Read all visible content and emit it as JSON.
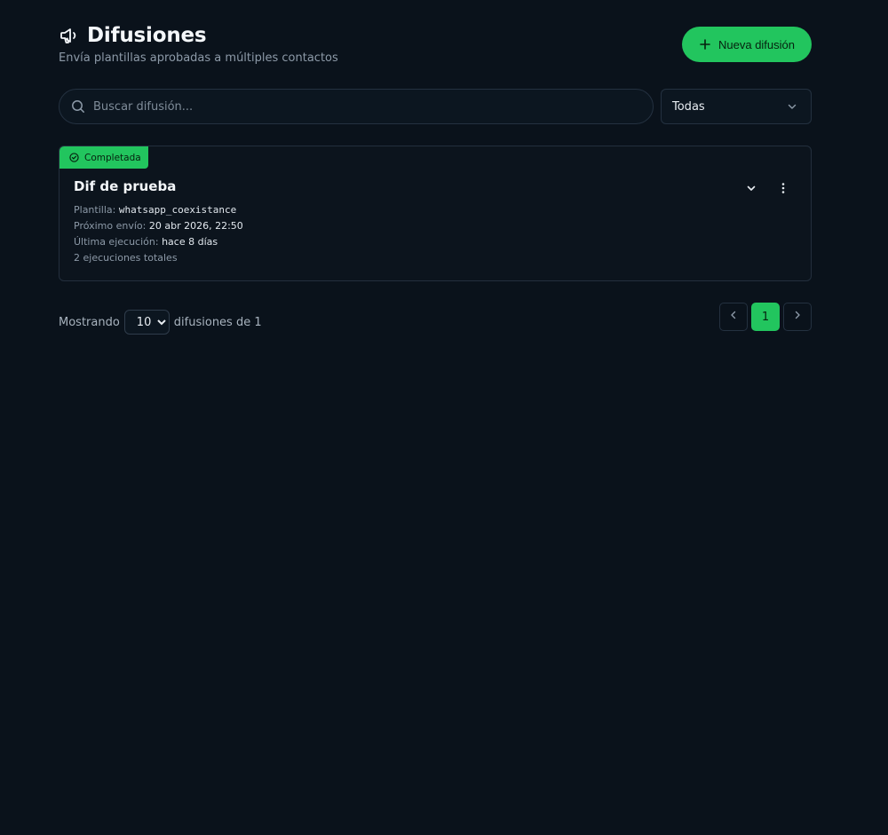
{
  "header": {
    "title": "Difusiones",
    "subtitle": "Envía plantillas aprobadas a múltiples contactos",
    "new_button_label": "Nueva difusión"
  },
  "search": {
    "placeholder": "Buscar difusión..."
  },
  "filter": {
    "selected": "Todas"
  },
  "broadcasts": [
    {
      "status": "Completada",
      "name": "Dif de prueba",
      "template_label": "Plantilla:",
      "template_value": "whatsapp_coexistance",
      "next_send_label": "Próximo envío:",
      "next_send_value": "20 abr 2026, 22:50",
      "last_run_label": "Última ejecución:",
      "last_run_value": "hace 8 días",
      "total_runs": "2 ejecuciones totales"
    }
  ],
  "footer": {
    "showing_label": "Mostrando",
    "page_size": "10",
    "total_label": "difusiones de 1",
    "current_page": "1"
  },
  "colors": {
    "background": "#0a121b",
    "accent": "#22c55e"
  }
}
